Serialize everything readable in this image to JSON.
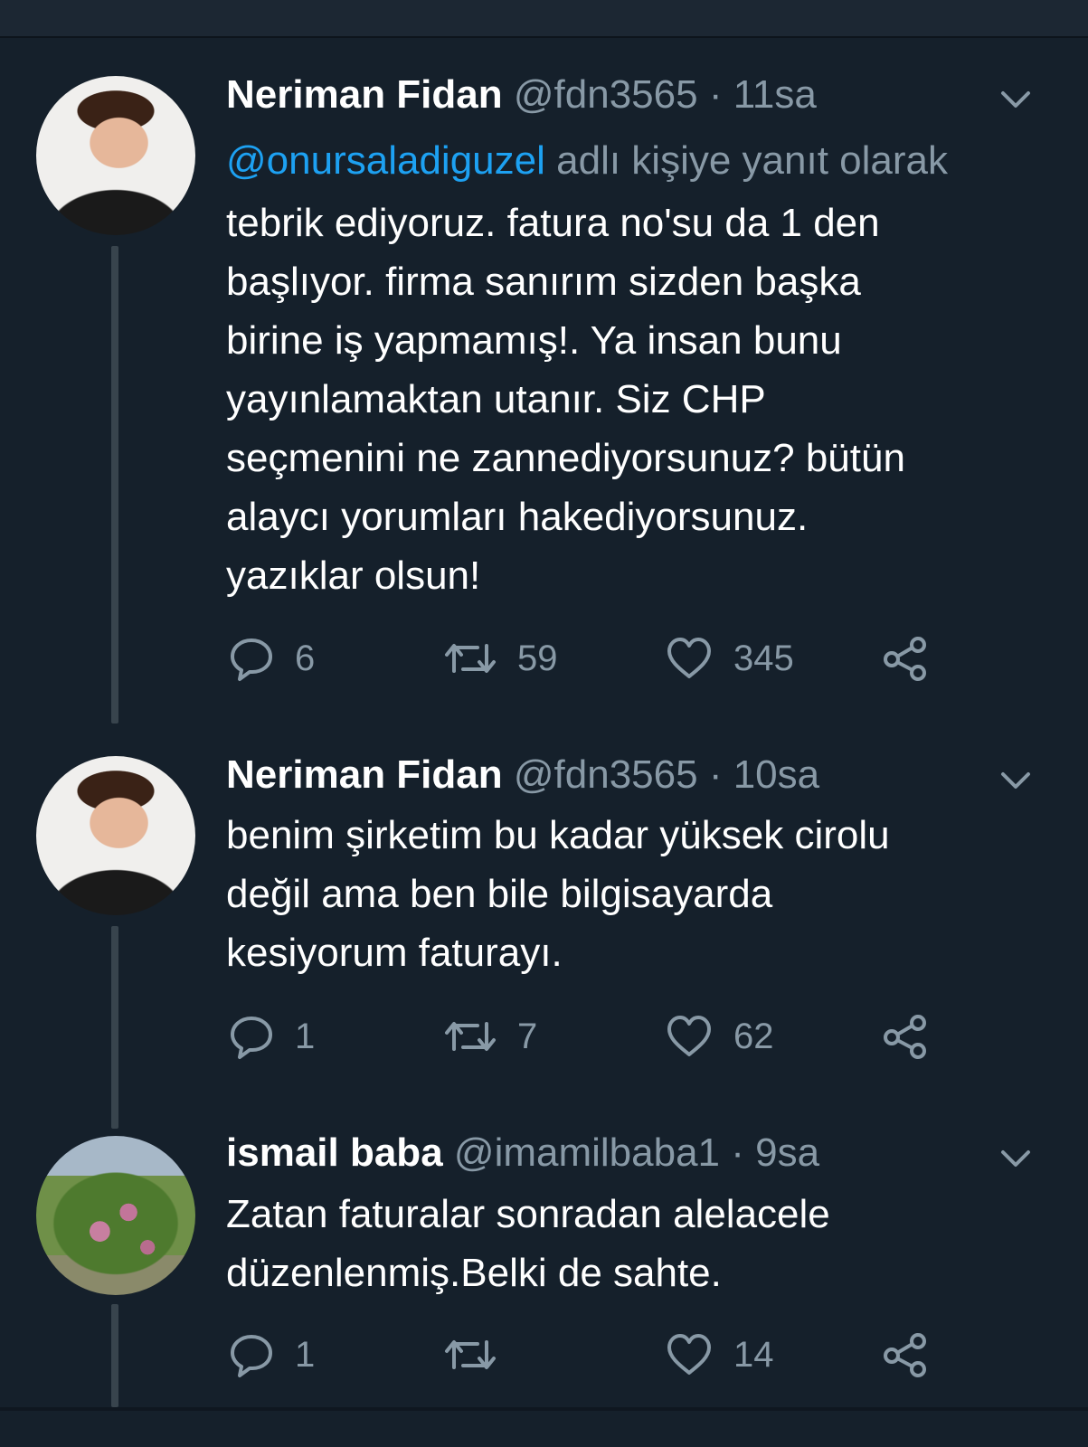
{
  "colors": {
    "background": "#15202b",
    "link": "#1da1f2",
    "muted": "#8899a6",
    "text": "#ffffff"
  },
  "tweets": [
    {
      "name": "Neriman Fidan",
      "handle": "@fdn3565",
      "time": "11sa",
      "reply_mention": "@onursaladiguzel",
      "reply_suffix": "adlı kişiye yanıt olarak",
      "lines": [
        "tebrik ediyoruz. fatura no'su da 1 den",
        "başlıyor. firma sanırım sizden başka",
        "birine iş yapmamış!. Ya insan bunu",
        "yayınlamaktan utanır. Siz CHP",
        "seçmenini ne zannediyorsunuz? bütün",
        "alaycı yorumları hakediyorsunuz.",
        "yazıklar olsun!"
      ],
      "replies": "6",
      "retweets": "59",
      "likes": "345",
      "avatar_icon": "profile-photo-woman"
    },
    {
      "name": "Neriman Fidan",
      "handle": "@fdn3565",
      "time": "10sa",
      "lines": [
        "benim şirketim bu kadar yüksek cirolu",
        "değil ama ben bile bilgisayarda",
        "kesiyorum faturayı."
      ],
      "replies": "1",
      "retweets": "7",
      "likes": "62",
      "avatar_icon": "profile-photo-woman"
    },
    {
      "name": "ismail baba",
      "handle": "@imamilbaba1",
      "time": "9sa",
      "lines": [
        "Zatan faturalar sonradan alelacele",
        "düzenlenmiş.Belki de sahte."
      ],
      "replies": "1",
      "retweets": "",
      "likes": "14",
      "avatar_icon": "profile-photo-plant"
    }
  ],
  "separator": "·"
}
